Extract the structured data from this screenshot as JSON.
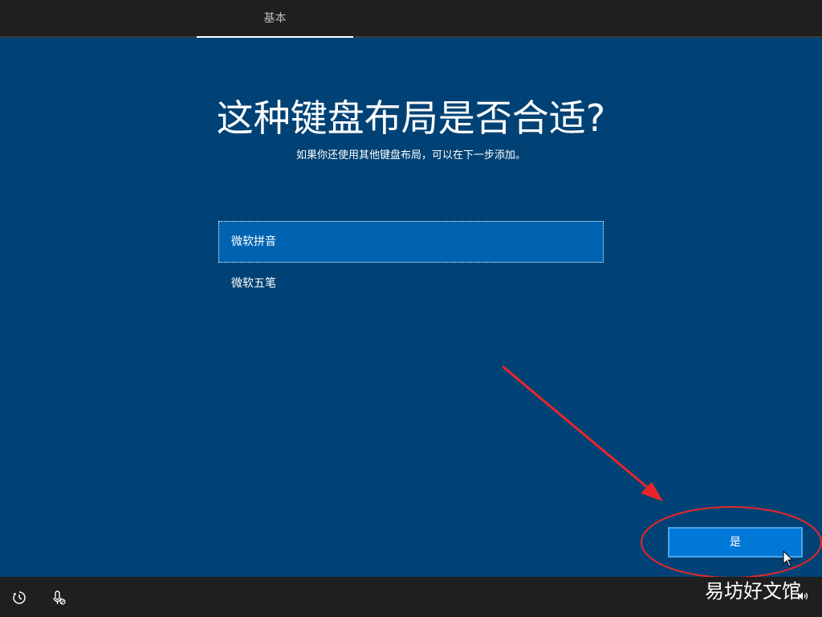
{
  "header": {
    "tab_label": "基本"
  },
  "main": {
    "title": "这种键盘布局是否合适?",
    "subtitle": "如果你还使用其他键盘布局，可以在下一步添加。",
    "options": [
      {
        "label": "微软拼音",
        "selected": true
      },
      {
        "label": "微软五笔",
        "selected": false
      }
    ],
    "confirm_label": "是"
  },
  "footer": {
    "icons": [
      "accessibility-icon",
      "microphone-icon"
    ],
    "watermark": "易坊好文馆"
  },
  "colors": {
    "background": "#004275",
    "selected_option": "#0063b1",
    "button": "#0078d7",
    "bar": "#1f1f1f",
    "annotation": "#e8262a"
  }
}
